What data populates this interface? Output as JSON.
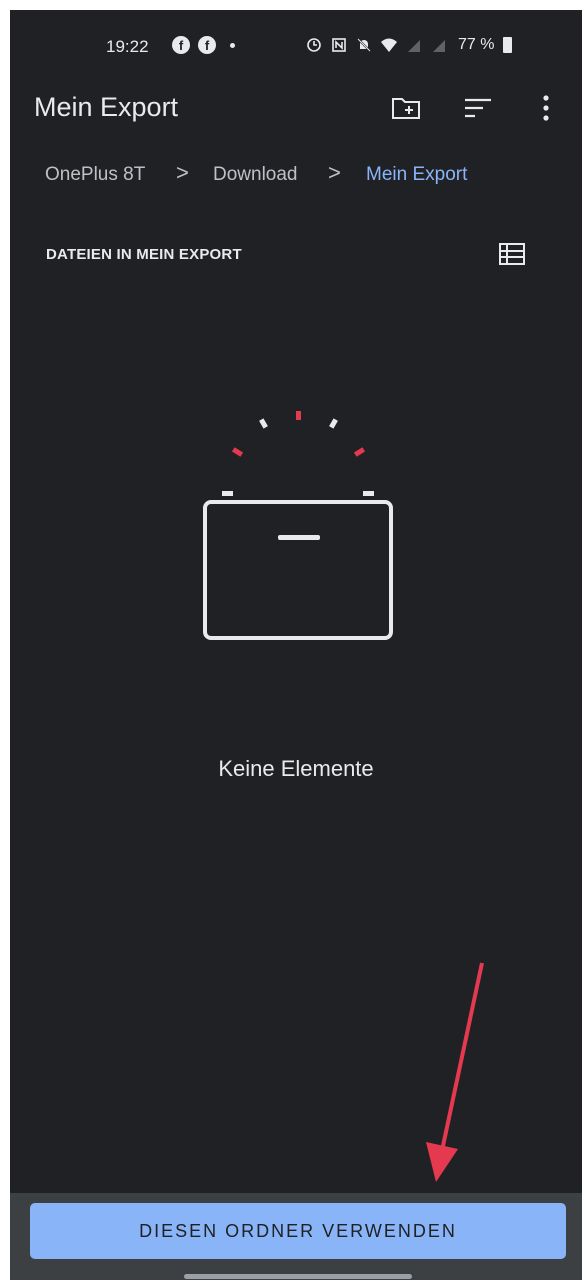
{
  "status_bar": {
    "time": "19:22",
    "left_icons": [
      "facebook-icon",
      "facebook-icon",
      "dot-icon"
    ],
    "right_icons": [
      "data-saver-icon",
      "nfc-icon",
      "mute-icon",
      "wifi-icon",
      "signal-icon",
      "signal-icon"
    ],
    "battery": "77 %"
  },
  "app_bar": {
    "title": "Mein Export",
    "actions": [
      "new-folder-icon",
      "sort-icon",
      "more-vert-icon"
    ]
  },
  "breadcrumb": {
    "items": [
      "OnePlus 8T",
      "Download",
      "Mein Export"
    ],
    "separator": ">"
  },
  "section": {
    "header": "DATEIEN IN MEIN EXPORT",
    "view_toggle_icon": "list-view-icon"
  },
  "empty_state": {
    "icon": "empty-box-icon",
    "text": "Keine Elemente"
  },
  "bottom": {
    "button_label": "DIESEN ORDNER VERWENDEN"
  },
  "colors": {
    "background": "#202124",
    "accent": "#8ab4f8",
    "bottom_bar": "#3c4043",
    "arrow": "#e53950"
  }
}
